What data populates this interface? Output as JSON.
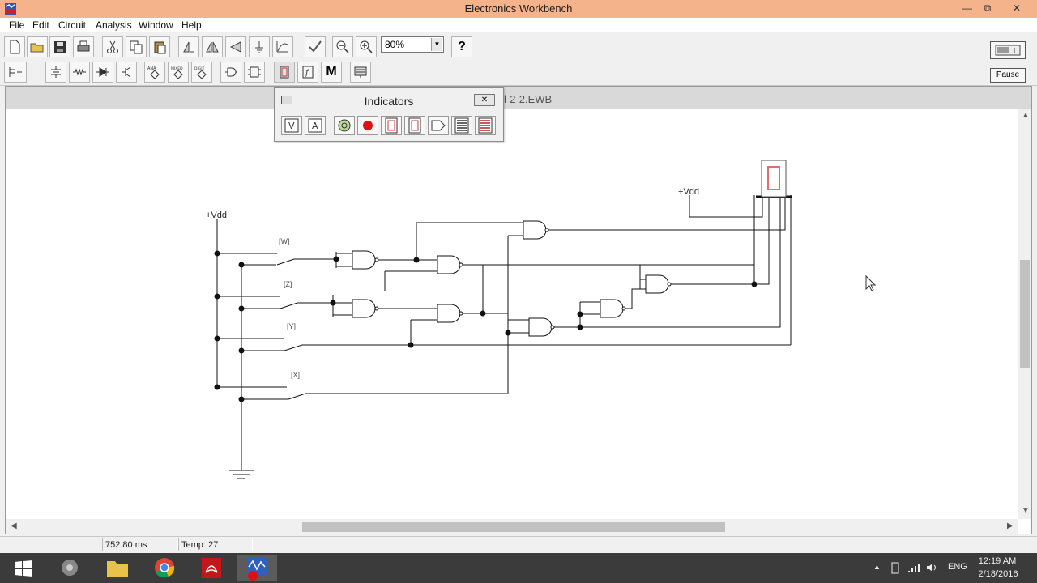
{
  "window": {
    "title": "Electronics Workbench"
  },
  "menu": {
    "items": [
      "File",
      "Edit",
      "Circuit",
      "Analysis",
      "Window",
      "Help"
    ]
  },
  "toolbar": {
    "zoom": "80%",
    "help_label": "?",
    "pause_label": "Pause",
    "bin_labels": [
      "ANA",
      "MIXED",
      "DIGIT"
    ],
    "misc_label": "M"
  },
  "circuit": {
    "file_title": "l-2-2.EWB",
    "vdd_labels": [
      "+Vdd",
      "+Vdd"
    ],
    "switch_labels": [
      "[W]",
      "[Z]",
      "[Y]",
      "[X]"
    ]
  },
  "indicators": {
    "title": "Indicators",
    "buttons": [
      "V",
      "A"
    ]
  },
  "status": {
    "time": "752.80 ms",
    "temp": "Temp:  27"
  },
  "taskbar": {
    "lang": "ENG",
    "time": "12:19 AM",
    "date": "2/18/2016"
  },
  "colors": {
    "titlebar": "#f5b38b",
    "display_segment": "#e07070",
    "taskbar": "#3b3b3b"
  }
}
